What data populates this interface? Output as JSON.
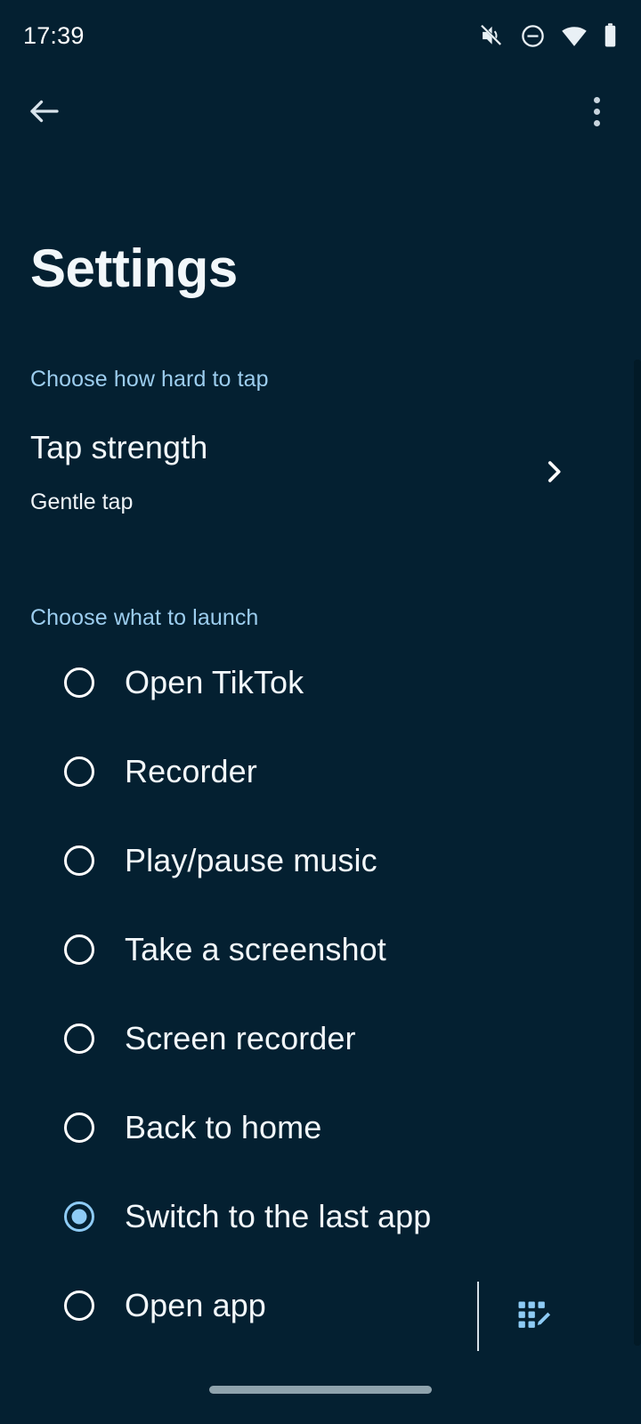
{
  "status_bar": {
    "time": "17:39",
    "icons": [
      {
        "name": "volume-mute-icon",
        "label": "Silent"
      },
      {
        "name": "do-not-disturb-icon",
        "label": "Do not disturb"
      },
      {
        "name": "wifi-icon",
        "label": "Wi-Fi"
      },
      {
        "name": "battery-icon",
        "label": "Battery"
      }
    ]
  },
  "action_bar": {
    "back_label": "Back",
    "overflow_label": "More options"
  },
  "page": {
    "title": "Settings"
  },
  "sections": {
    "tap": {
      "header": "Choose how hard to tap",
      "row": {
        "title": "Tap strength",
        "value": "Gentle tap",
        "chevron": "chevron-right-icon"
      }
    },
    "launch": {
      "header": "Choose what to launch",
      "options": [
        {
          "label": "Open TikTok",
          "selected": false
        },
        {
          "label": "Recorder",
          "selected": false
        },
        {
          "label": "Play/pause music",
          "selected": false
        },
        {
          "label": "Take a screenshot",
          "selected": false
        },
        {
          "label": "Screen recorder",
          "selected": false
        },
        {
          "label": "Back to home",
          "selected": false
        },
        {
          "label": "Switch to the last app",
          "selected": true
        },
        {
          "label": "Open app",
          "selected": false
        }
      ],
      "edit_apps_label": "Edit apps"
    }
  },
  "nav_bar": {
    "home_indicator_label": "Home"
  },
  "colors": {
    "background": "#042031",
    "accent_blue": "#9ccdee",
    "selected_radio": "#8ecbf5",
    "primary_text": "#f2f7fa",
    "home_indicator": "#8fa3ad"
  }
}
